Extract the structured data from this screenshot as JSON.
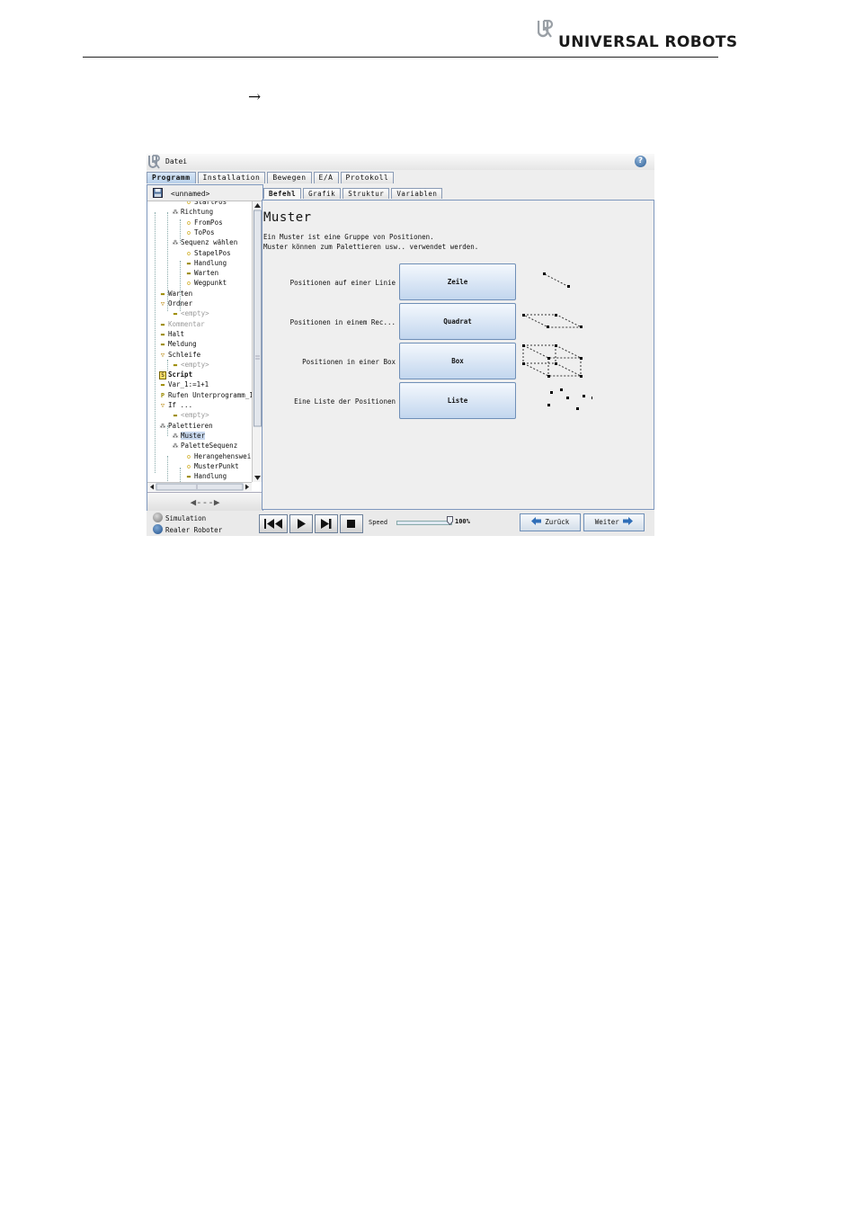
{
  "page": {
    "brand": "UNIVERSAL ROBOTS",
    "arrow": "→"
  },
  "window": {
    "menu_file": "Datei",
    "help": "?",
    "main_tabs": [
      "Programm",
      "Installation",
      "Bewegen",
      "E/A",
      "Protokoll"
    ],
    "program_name": "<unnamed>",
    "tree_nav": "◀---▶",
    "tree": [
      {
        "label": "StartPos",
        "icon": "position-icon",
        "level": 3
      },
      {
        "label": "Richtung",
        "icon": "pallet-icon",
        "level": 2
      },
      {
        "label": "FromPos",
        "icon": "position-icon",
        "level": 3
      },
      {
        "label": "ToPos",
        "icon": "position-icon",
        "level": 3
      },
      {
        "label": "Sequenz wählen",
        "icon": "pallet-icon",
        "level": 2
      },
      {
        "label": "StapelPos",
        "icon": "position-icon",
        "level": 3
      },
      {
        "label": "Handlung",
        "icon": "wait-icon",
        "level": 3
      },
      {
        "label": "Warten",
        "icon": "wait-icon",
        "level": 3
      },
      {
        "label": "Wegpunkt",
        "icon": "position-icon",
        "level": 3
      },
      {
        "label": "Warten",
        "icon": "wait-icon",
        "level": 1
      },
      {
        "label": "Ordner",
        "icon": "folder-icon",
        "level": 1
      },
      {
        "label": "<empty>",
        "icon": "wait-icon",
        "level": 2,
        "dim": true
      },
      {
        "label": "Kommentar",
        "icon": "wait-icon",
        "level": 1,
        "dim": true
      },
      {
        "label": "Halt",
        "icon": "wait-icon",
        "level": 1
      },
      {
        "label": "Meldung",
        "icon": "wait-icon",
        "level": 1
      },
      {
        "label": "Schleife",
        "icon": "folder-icon",
        "level": 1
      },
      {
        "label": "<empty>",
        "icon": "wait-icon",
        "level": 2,
        "dim": true
      },
      {
        "label": "Script",
        "icon": "script-icon",
        "level": 1,
        "bold": true
      },
      {
        "label": "Var_1:=1+1",
        "icon": "wait-icon",
        "level": 1
      },
      {
        "label": "Rufen Unterprogramm_1",
        "icon": "call-icon",
        "level": 1
      },
      {
        "label": "If ...",
        "icon": "folder-icon",
        "level": 1
      },
      {
        "label": "<empty>",
        "icon": "wait-icon",
        "level": 2,
        "dim": true
      },
      {
        "label": "Palettieren",
        "icon": "pallet-icon",
        "level": 1
      },
      {
        "label": "Muster",
        "icon": "pallet-icon",
        "level": 2,
        "selected": true
      },
      {
        "label": "PaletteSequenz",
        "icon": "pallet-icon",
        "level": 2
      },
      {
        "label": "Herangehensweise",
        "icon": "position-icon",
        "level": 3
      },
      {
        "label": "MusterPunkt",
        "icon": "position-icon",
        "level": 3
      },
      {
        "label": "Handlung",
        "icon": "wait-icon",
        "level": 3
      }
    ],
    "sub_tabs": [
      "Befehl",
      "Grafik",
      "Struktur",
      "Variablen"
    ],
    "content": {
      "title": "Muster",
      "desc1": "Ein Muster ist eine Gruppe von Positionen.",
      "desc2": "Muster können zum Palettieren usw.. verwendet werden.",
      "rows": [
        {
          "label": "Positionen auf einer Linie",
          "button": "Zeile"
        },
        {
          "label": "Positionen in einem Rec...",
          "button": "Quadrat"
        },
        {
          "label": "Positionen in einer Box",
          "button": "Box"
        },
        {
          "label": "Eine Liste der Positionen",
          "button": "Liste"
        }
      ]
    },
    "status": {
      "simulation": "Simulation",
      "real_robot": "Realer Roboter",
      "speed_label": "Speed",
      "speed_value": "100%",
      "speed_fraction": 1.0,
      "back": "Zurück",
      "next": "Weiter"
    }
  }
}
